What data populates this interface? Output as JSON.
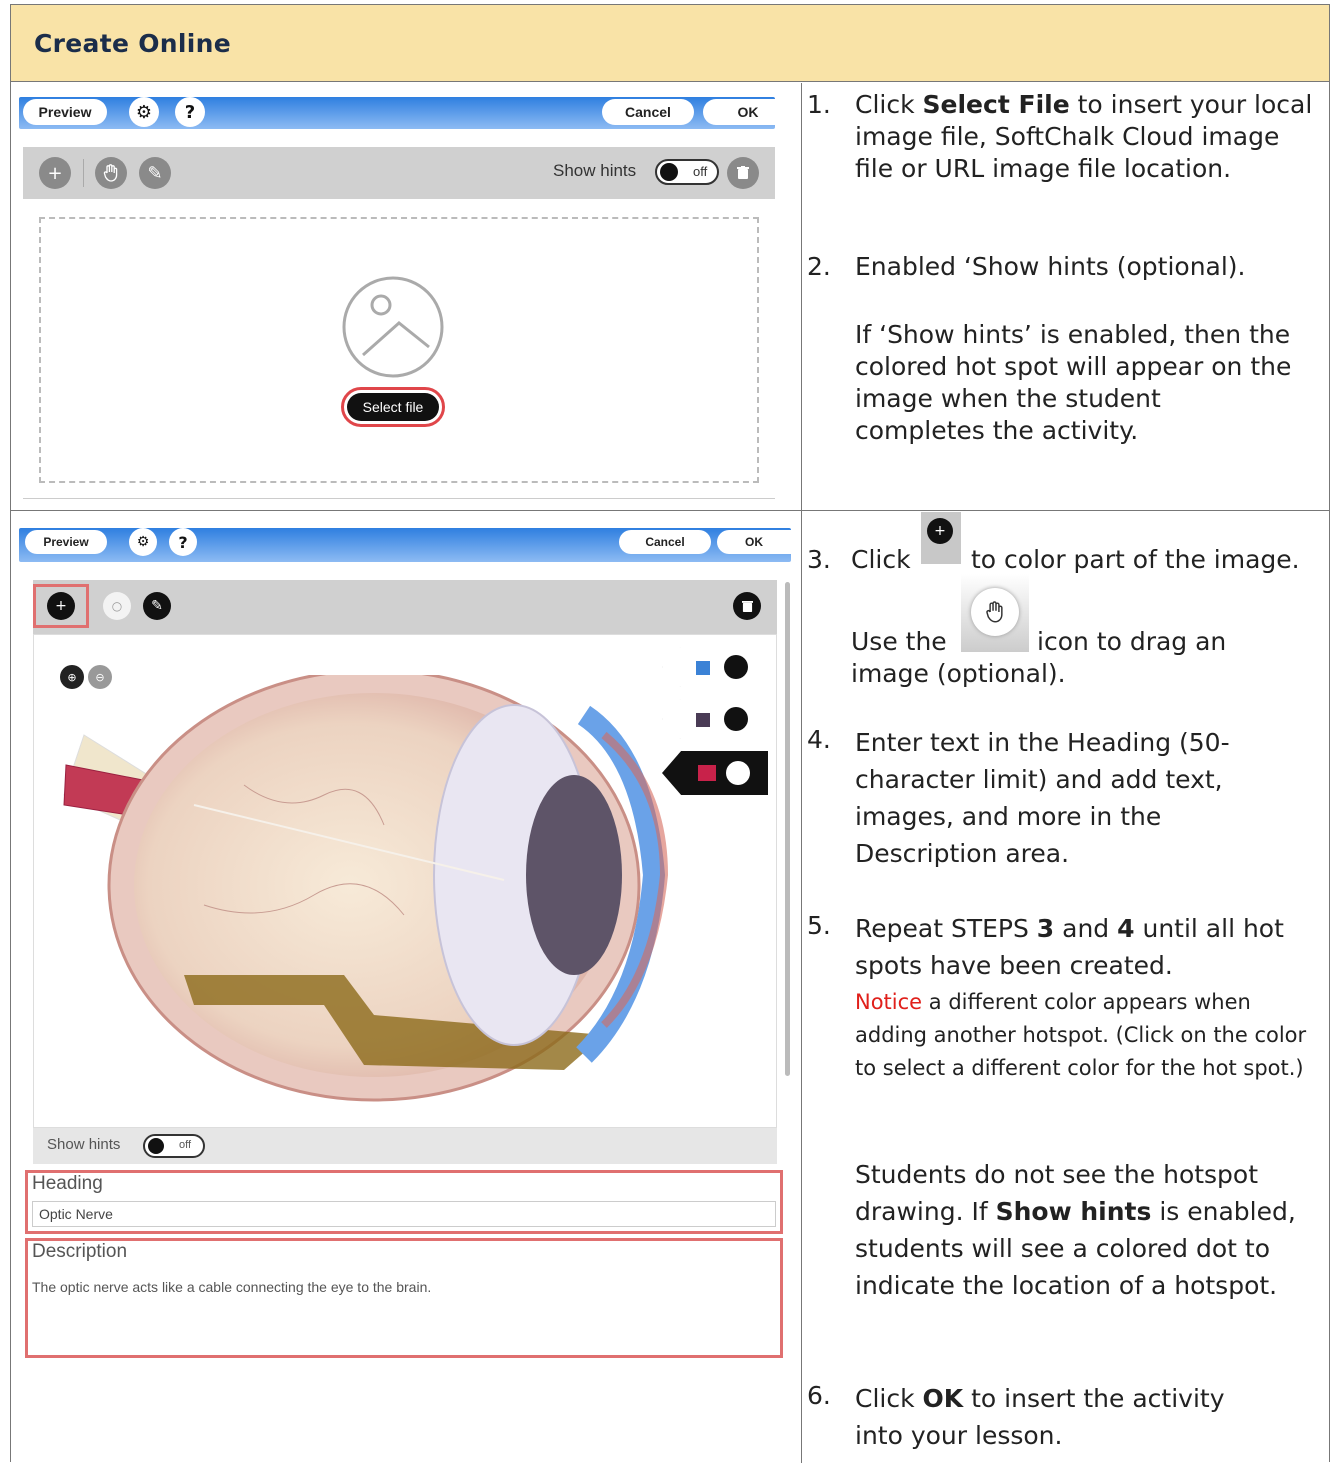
{
  "header": {
    "title": "Create Online"
  },
  "editor1": {
    "preview": "Preview",
    "gear": "⚙",
    "help": "?",
    "cancel": "Cancel",
    "ok": "OK",
    "show_hints": "Show hints",
    "toggle": "off",
    "select_file": "Select file"
  },
  "steps1": {
    "s1_num": "1.",
    "s1_a": "Click ",
    "s1_b": "Select File",
    "s1_c": " to insert your local image file, SoftChalk Cloud image file or URL image file location.",
    "s2_num": "2.",
    "s2": "Enabled ‘Show hints (optional).",
    "s2_note": "If ‘Show hints’ is enabled, then the colored hot spot will appear on the image when the student completes the activity."
  },
  "editor2": {
    "preview": "Preview",
    "gear": "⚙",
    "help": "?",
    "cancel": "Cancel",
    "ok": "OK",
    "show_hints": "Show hints",
    "toggle": "off",
    "heading_label": "Heading",
    "heading_value": "Optic Nerve",
    "description_label": "Description",
    "description_value": "The optic nerve acts like a cable connecting the eye to the brain.",
    "hotspot_colors": [
      "#3b82d6",
      "#4a3b55",
      "#c8224a"
    ]
  },
  "steps2": {
    "s3_num": "3.",
    "s3_a": "Click",
    "s3_b": "to color part of the image.",
    "s3_use": "Use the",
    "s3_icon": "icon to drag an",
    "s3_cont": "image (optional).",
    "s4_num": "4.",
    "s4": "Enter text in the Heading (50-character limit) and add text, images, and more in the Description area.",
    "s5_num": "5.",
    "s5_a": "Repeat STEPS ",
    "s5_b": "3",
    "s5_c": " and ",
    "s5_d": "4",
    "s5_e": " until all hot spots have been created.",
    "notice_word": "Notice",
    "notice_rest": " a different color appears when adding another hotspot. (Click on the color to select a different color for the hot spot.)",
    "students_a": "Students do not see the hotspot drawing. If ",
    "students_b": "Show hints",
    "students_c": " is enabled, students will see a colored dot to indicate the location of a hotspot.",
    "s6_num": "6.",
    "s6_a": "Click ",
    "s6_b": "OK",
    "s6_c": " to insert the activity into your lesson."
  }
}
